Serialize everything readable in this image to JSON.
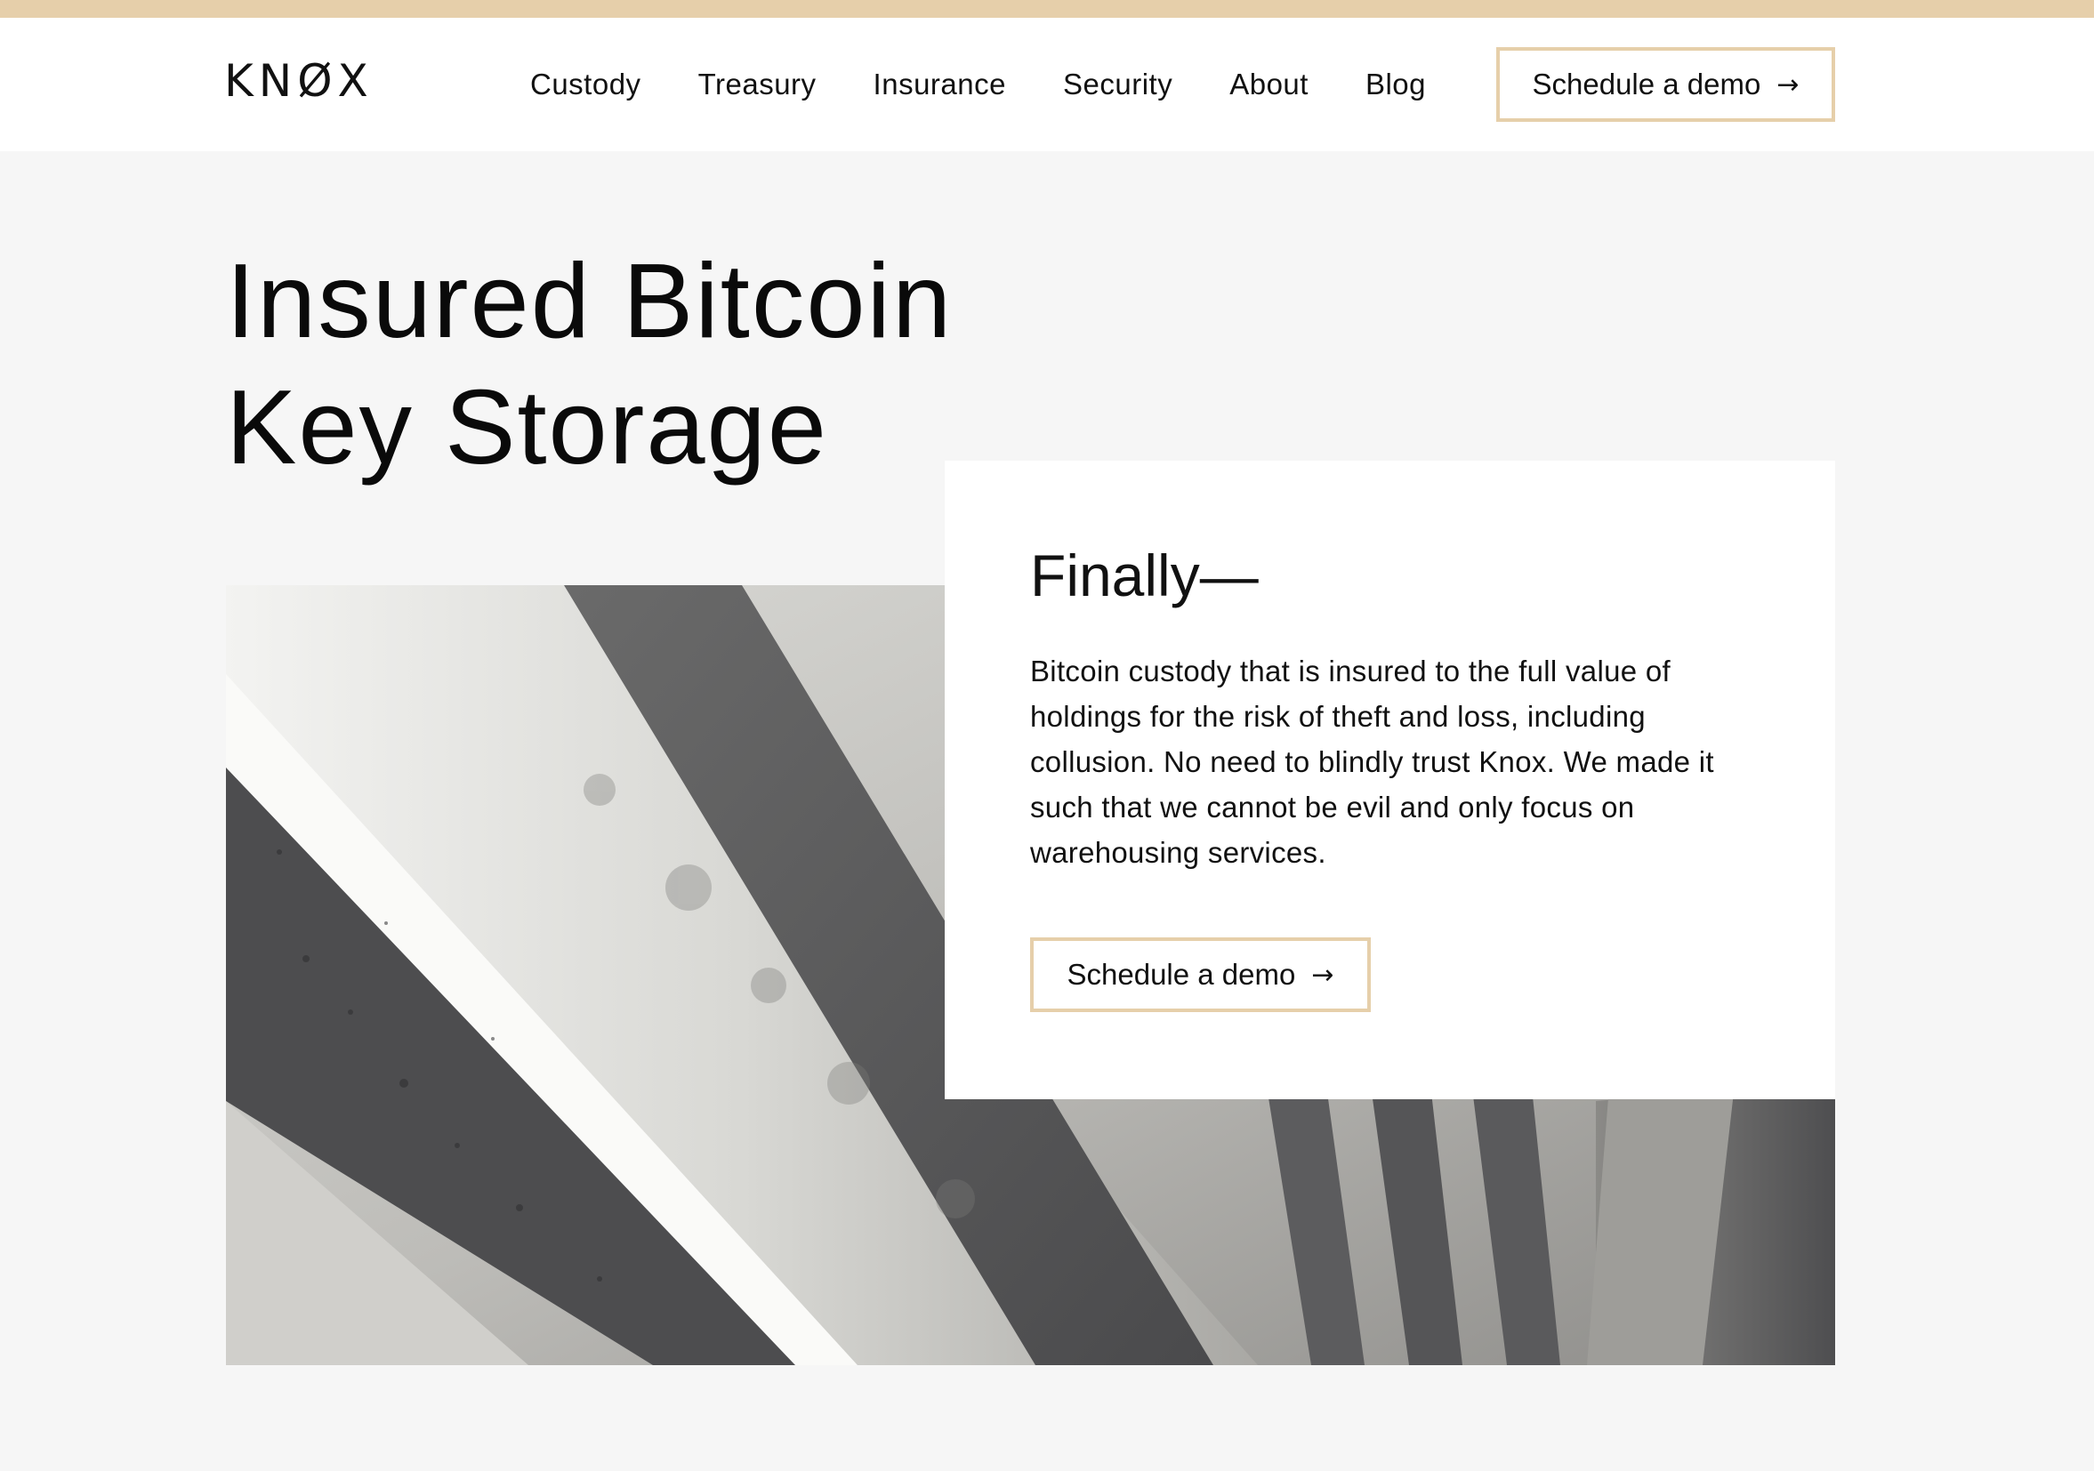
{
  "brand": {
    "logo": "KNØX",
    "accent_color": "#e6cfaa"
  },
  "nav": {
    "links": [
      {
        "label": "Custody"
      },
      {
        "label": "Treasury"
      },
      {
        "label": "Insurance"
      },
      {
        "label": "Security"
      },
      {
        "label": "About"
      },
      {
        "label": "Blog"
      }
    ],
    "cta_label": "Schedule a demo",
    "cta_icon": "arrow-right-icon"
  },
  "hero": {
    "title_line1": "Insured Bitcoin",
    "title_line2": "Key Storage",
    "image_subject": "concrete-beams-photo"
  },
  "card": {
    "heading": "Finally—",
    "body": "Bitcoin custody that is insured to the full value of holdings for the risk of theft and loss, including collusion. No need to blindly trust Knox. We made it such that we cannot be evil and only focus on warehousing services.",
    "cta_label": "Schedule a demo",
    "cta_icon": "arrow-right-icon"
  }
}
